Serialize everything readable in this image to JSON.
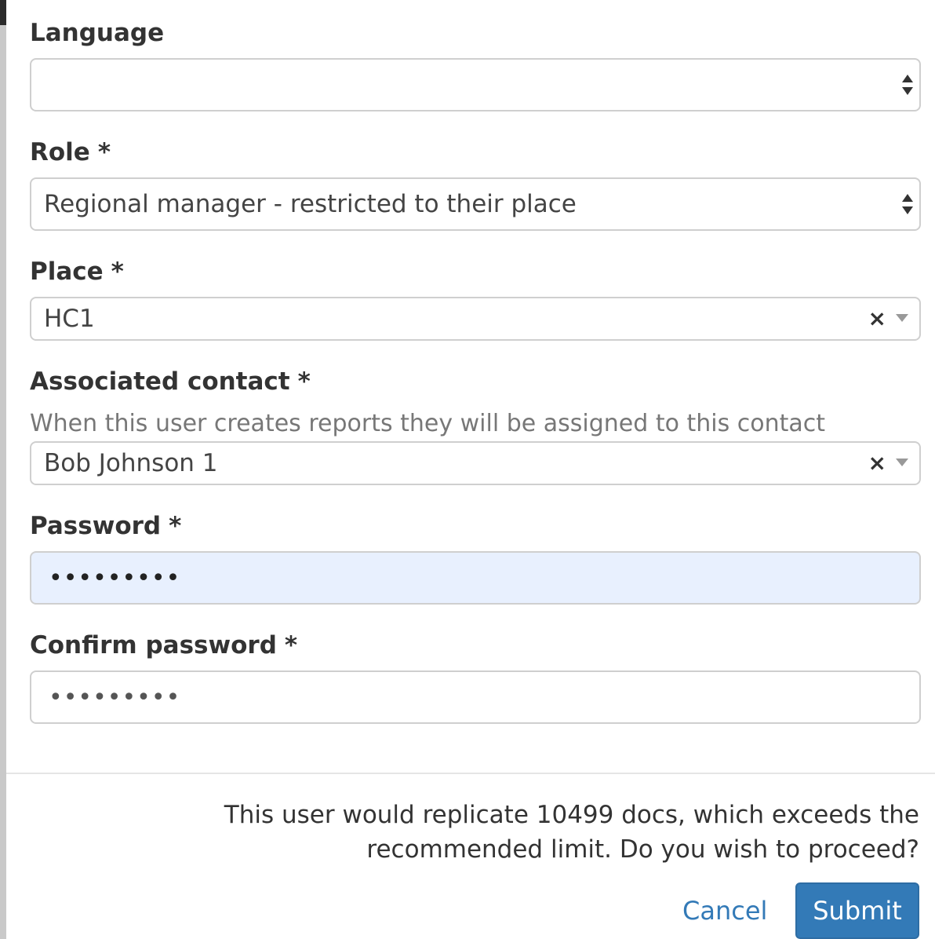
{
  "form": {
    "language": {
      "label": "Language",
      "value": ""
    },
    "role": {
      "label": "Role",
      "required_mark": "*",
      "value": "Regional manager - restricted to their place"
    },
    "place": {
      "label": "Place",
      "required_mark": "*",
      "value": "HC1",
      "clear_symbol": "×"
    },
    "associated_contact": {
      "label": "Associated contact",
      "required_mark": "*",
      "help_text": "When this user creates reports they will be assigned to this contact",
      "value": "Bob Johnson 1",
      "clear_symbol": "×"
    },
    "password": {
      "label": "Password",
      "required_mark": "*",
      "masked_value": "•••••••••",
      "autofill_background": "#e8f0fe"
    },
    "confirm_password": {
      "label": "Confirm password",
      "required_mark": "*",
      "masked_value": "•••••••••"
    }
  },
  "footer": {
    "warning_text": "This user would replicate 10499 docs, which exceeds the recommended limit. Do you wish to proceed?",
    "cancel_label": "Cancel",
    "submit_label": "Submit"
  },
  "colors": {
    "primary": "#337ab7",
    "border": "#cfcfcf",
    "help_text": "#777777"
  }
}
